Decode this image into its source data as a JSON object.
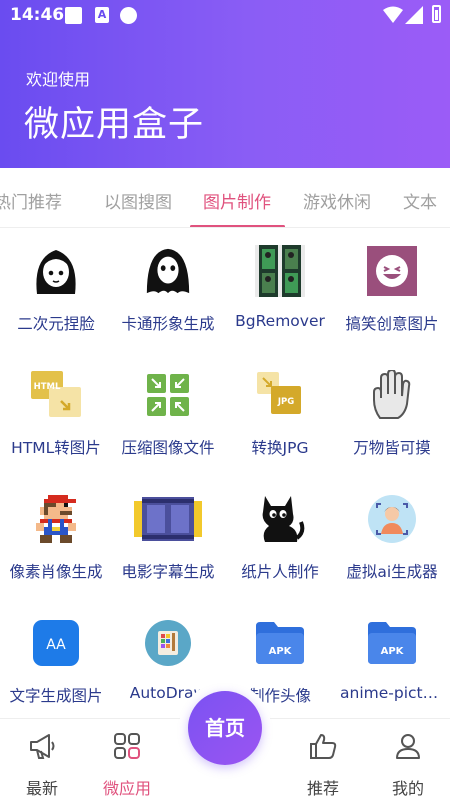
{
  "status_bar": {
    "time": "14:46",
    "notif_a": "A"
  },
  "header": {
    "welcome": "欢迎使用",
    "title": "微应用盒子"
  },
  "tabs": [
    {
      "label": "热门推荐"
    },
    {
      "label": "以图搜图"
    },
    {
      "label": "图片制作"
    },
    {
      "label": "游戏休闲"
    },
    {
      "label": "文本"
    }
  ],
  "active_tab": "图片制作",
  "apps": [
    {
      "label": "二次元捏脸",
      "icon": "anime-girl-icon"
    },
    {
      "label": "卡通形象生成",
      "icon": "ghost-mask-icon"
    },
    {
      "label": "BgRemover",
      "icon": "film-strip-people-icon"
    },
    {
      "label": "搞笑创意图片",
      "icon": "laughing-face-icon"
    },
    {
      "label": "HTML转图片",
      "icon": "html-convert-icon",
      "badge": "HTML"
    },
    {
      "label": "压缩图像文件",
      "icon": "compress-arrows-icon"
    },
    {
      "label": "转换JPG",
      "icon": "jpg-convert-icon",
      "badge": "JPG"
    },
    {
      "label": "万物皆可摸",
      "icon": "hand-icon"
    },
    {
      "label": "像素肖像生成",
      "icon": "pixel-mario-icon"
    },
    {
      "label": "电影字幕生成",
      "icon": "film-reel-icon"
    },
    {
      "label": "纸片人制作",
      "icon": "black-cat-icon"
    },
    {
      "label": "虚拟ai生成器",
      "icon": "ai-avatar-icon"
    },
    {
      "label": "文字生成图片",
      "icon": "text-aa-icon",
      "badge": "AA"
    },
    {
      "label": "AutoDraw",
      "icon": "palette-icon"
    },
    {
      "label": "制作头像",
      "icon": "apk-folder-icon",
      "badge": "APK"
    },
    {
      "label": "anime-picture",
      "icon": "apk-folder-icon-2",
      "badge": "APK"
    }
  ],
  "bottom_nav": {
    "latest": "最新",
    "micro_apps": "微应用",
    "home": "首页",
    "recommend": "推荐",
    "mine": "我的"
  },
  "colors": {
    "header_gradient_start": "#6a4cf0",
    "header_gradient_end": "#9b5cf7",
    "accent_pink": "#e0527e",
    "label_blue": "#2b3a8c",
    "home_button": "#8a55f2"
  }
}
